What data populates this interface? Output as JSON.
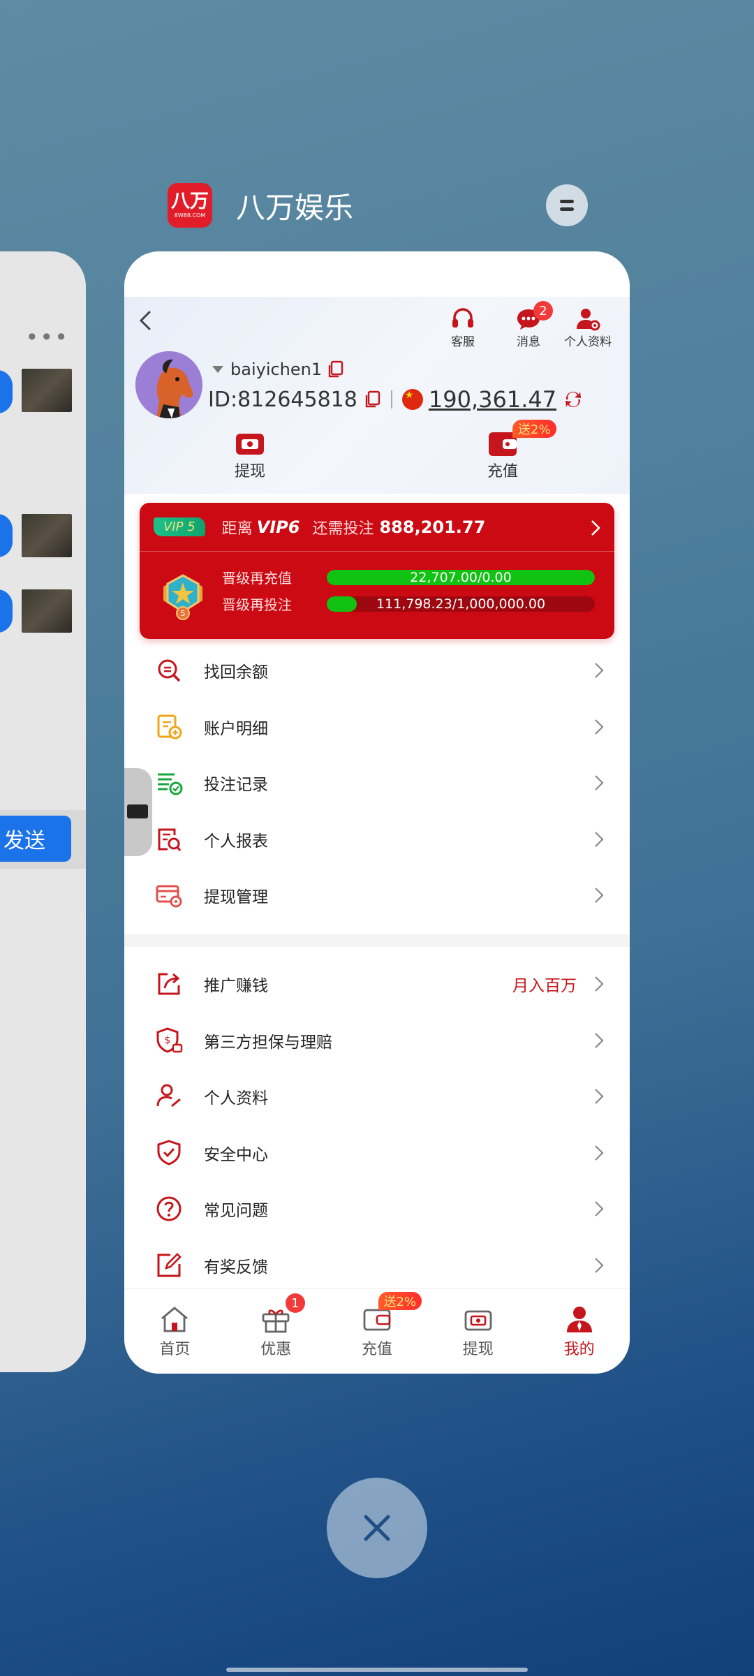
{
  "app": {
    "logo_line1": "八万",
    "logo_line2": "8W88.COM",
    "name": "八万娱乐"
  },
  "left_card": {
    "send_label": "发送"
  },
  "header": {
    "actions": [
      {
        "label": "客服",
        "icon": "headset-icon"
      },
      {
        "label": "消息",
        "icon": "chat-icon",
        "badge": "2"
      },
      {
        "label": "个人资料",
        "icon": "user-settings-icon"
      }
    ]
  },
  "profile": {
    "username": "baiyichen1",
    "id_label": "ID:",
    "id_value": "812645818",
    "balance": "190,361.47",
    "withdraw_label": "提现",
    "deposit_label": "充值",
    "deposit_promo": "送2%"
  },
  "vip": {
    "badge": "VIP 5",
    "distance_label": "距离",
    "next_level": "VIP6",
    "need_label": "还需投注",
    "need_amount": "888,201.77",
    "progress": [
      {
        "label": "晋级再充值",
        "text": "22,707.00/0.00",
        "fraction": 1.0
      },
      {
        "label": "晋级再投注",
        "text": "111,798.23/1,000,000.00",
        "fraction": 0.112
      }
    ]
  },
  "menu_group1": [
    {
      "label": "找回余额",
      "icon": "search-money-icon"
    },
    {
      "label": "账户明细",
      "icon": "account-detail-icon"
    },
    {
      "label": "投注记录",
      "icon": "bet-record-icon"
    },
    {
      "label": "个人报表",
      "icon": "report-icon"
    },
    {
      "label": "提现管理",
      "icon": "withdraw-manage-icon"
    }
  ],
  "menu_group2": [
    {
      "label": "推广赚钱",
      "icon": "share-icon",
      "extra": "月入百万"
    },
    {
      "label": "第三方担保与理赔",
      "icon": "shield-money-icon"
    },
    {
      "label": "个人资料",
      "icon": "user-edit-icon"
    },
    {
      "label": "安全中心",
      "icon": "shield-check-icon"
    },
    {
      "label": "常见问题",
      "icon": "question-icon"
    },
    {
      "label": "有奖反馈",
      "icon": "feedback-icon"
    }
  ],
  "bottom_nav": [
    {
      "label": "首页",
      "icon": "home-icon"
    },
    {
      "label": "优惠",
      "icon": "gift-icon",
      "badge": "1"
    },
    {
      "label": "充值",
      "icon": "wallet-icon",
      "promo": "送2%"
    },
    {
      "label": "提现",
      "icon": "withdraw-icon"
    },
    {
      "label": "我的",
      "icon": "profile-icon",
      "active": true
    }
  ],
  "colors": {
    "brand_red": "#c4161c",
    "vip_red": "#cc0a14",
    "progress_green": "#12c212",
    "send_blue": "#1a73e8"
  }
}
